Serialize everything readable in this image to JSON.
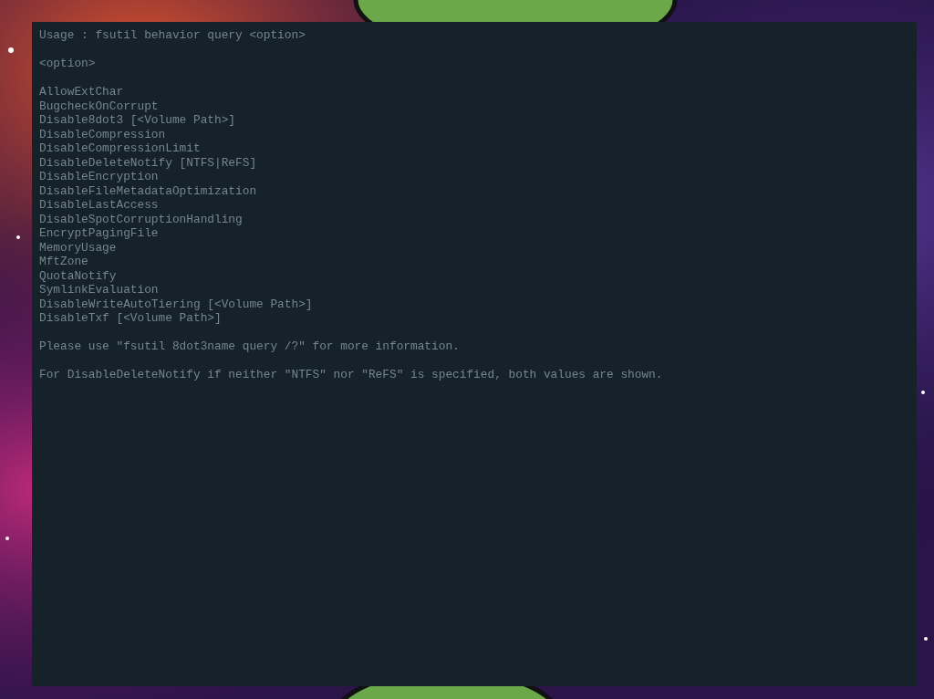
{
  "console": {
    "usage": "Usage : fsutil behavior query <option>",
    "options_heading": "<option>",
    "options": [
      "AllowExtChar",
      "BugcheckOnCorrupt",
      "Disable8dot3 [<Volume Path>]",
      "DisableCompression",
      "DisableCompressionLimit",
      "DisableDeleteNotify [NTFS|ReFS]",
      "DisableEncryption",
      "DisableFileMetadataOptimization",
      "DisableLastAccess",
      "DisableSpotCorruptionHandling",
      "EncryptPagingFile",
      "MemoryUsage",
      "MftZone",
      "QuotaNotify",
      "SymlinkEvaluation",
      "DisableWriteAutoTiering [<Volume Path>]",
      "DisableTxf [<Volume Path>]"
    ],
    "notes": [
      "Please use \"fsutil 8dot3name query /?\" for more information.",
      "For DisableDeleteNotify if neither \"NTFS\" nor \"ReFS\" is specified, both values are shown."
    ]
  }
}
